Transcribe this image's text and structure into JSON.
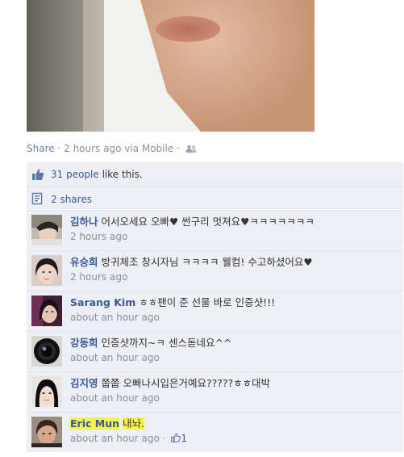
{
  "post": {
    "share_label": "Share",
    "separator": "·",
    "timestamp": "2 hours ago via Mobile",
    "separator2": "·"
  },
  "likes": {
    "count_text": "31 people",
    "suffix": " like this."
  },
  "shares": {
    "label": "2 shares"
  },
  "comments": [
    {
      "author": "김하나",
      "text": "어서오세요 오빠♥ 썬구리 멋져요♥ㅋㅋㅋㅋㅋㅋㅋ",
      "time": "2 hours ago"
    },
    {
      "author": "유승희",
      "text": "방귀체조 창시자님 ㅋㅋㅋㅋ 웰컴! 수고하셨어요♥",
      "time": "2 hours ago"
    },
    {
      "author": "Sarang Kim",
      "text": "ㅎㅎ팬이 준 선물 바로 인증샷!!!",
      "time": "about an hour ago"
    },
    {
      "author": "강동희",
      "text": "인증샷까지~ㅋ 센스돋네요^^",
      "time": "about an hour ago"
    },
    {
      "author": "김지영",
      "text": "쭙쭙 오빠나시입은거예요?????ㅎㅎ대박",
      "time": "about an hour ago"
    },
    {
      "author": "Eric Mun",
      "text": "내놔.",
      "time": "about an hour ago",
      "separator": "·",
      "likes": "1"
    }
  ],
  "colors": {
    "link": "#3b5998",
    "meta": "#898f9c",
    "panel": "#edeff4",
    "highlight": "#f3f34a"
  }
}
